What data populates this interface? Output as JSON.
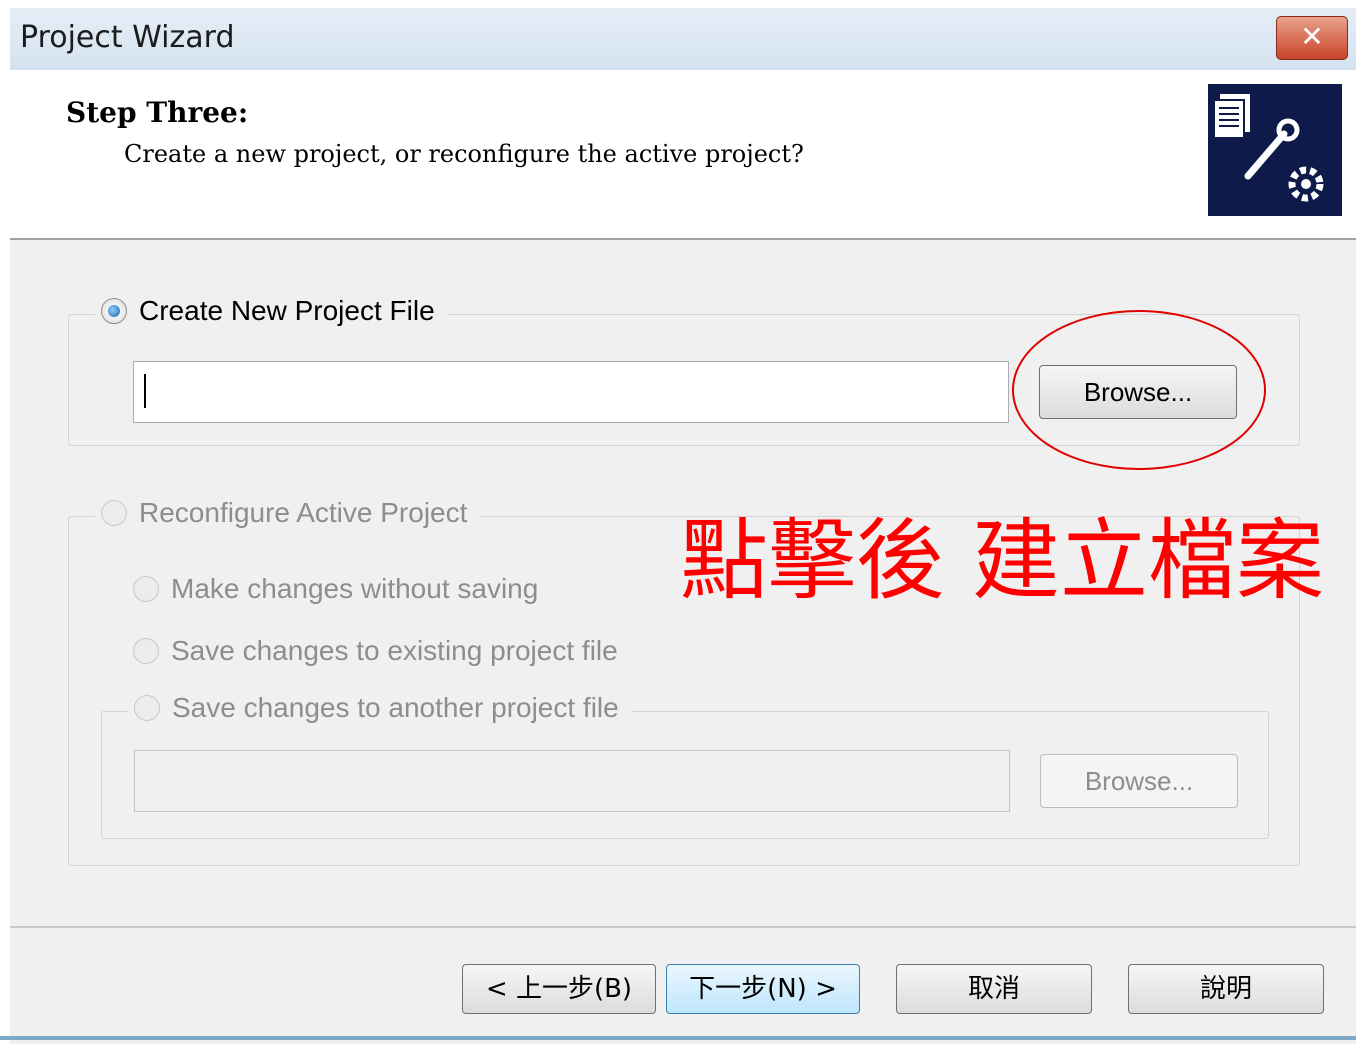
{
  "window": {
    "title": "Project Wizard",
    "close_label": "✕"
  },
  "header": {
    "step_title": "Step Three:",
    "step_subtitle": "Create a new project, or reconfigure the active project?",
    "icon": "project-wrench-gear-icon"
  },
  "create_group": {
    "radio_label": "Create New Project File",
    "selected": true,
    "path_value": "",
    "browse_label": "Browse..."
  },
  "reconfigure_group": {
    "radio_label": "Reconfigure Active Project",
    "options": [
      "Make changes without saving",
      "Save changes to existing project file",
      "Save changes to another project file"
    ],
    "path_value": "",
    "browse_label": "Browse..."
  },
  "annotation": {
    "text": "點擊後 建立檔案",
    "color": "#ff0000"
  },
  "footer": {
    "back_label": "< 上一步(B)",
    "next_label": "下一步(N) >",
    "cancel_label": "取消",
    "help_label": "說明"
  }
}
